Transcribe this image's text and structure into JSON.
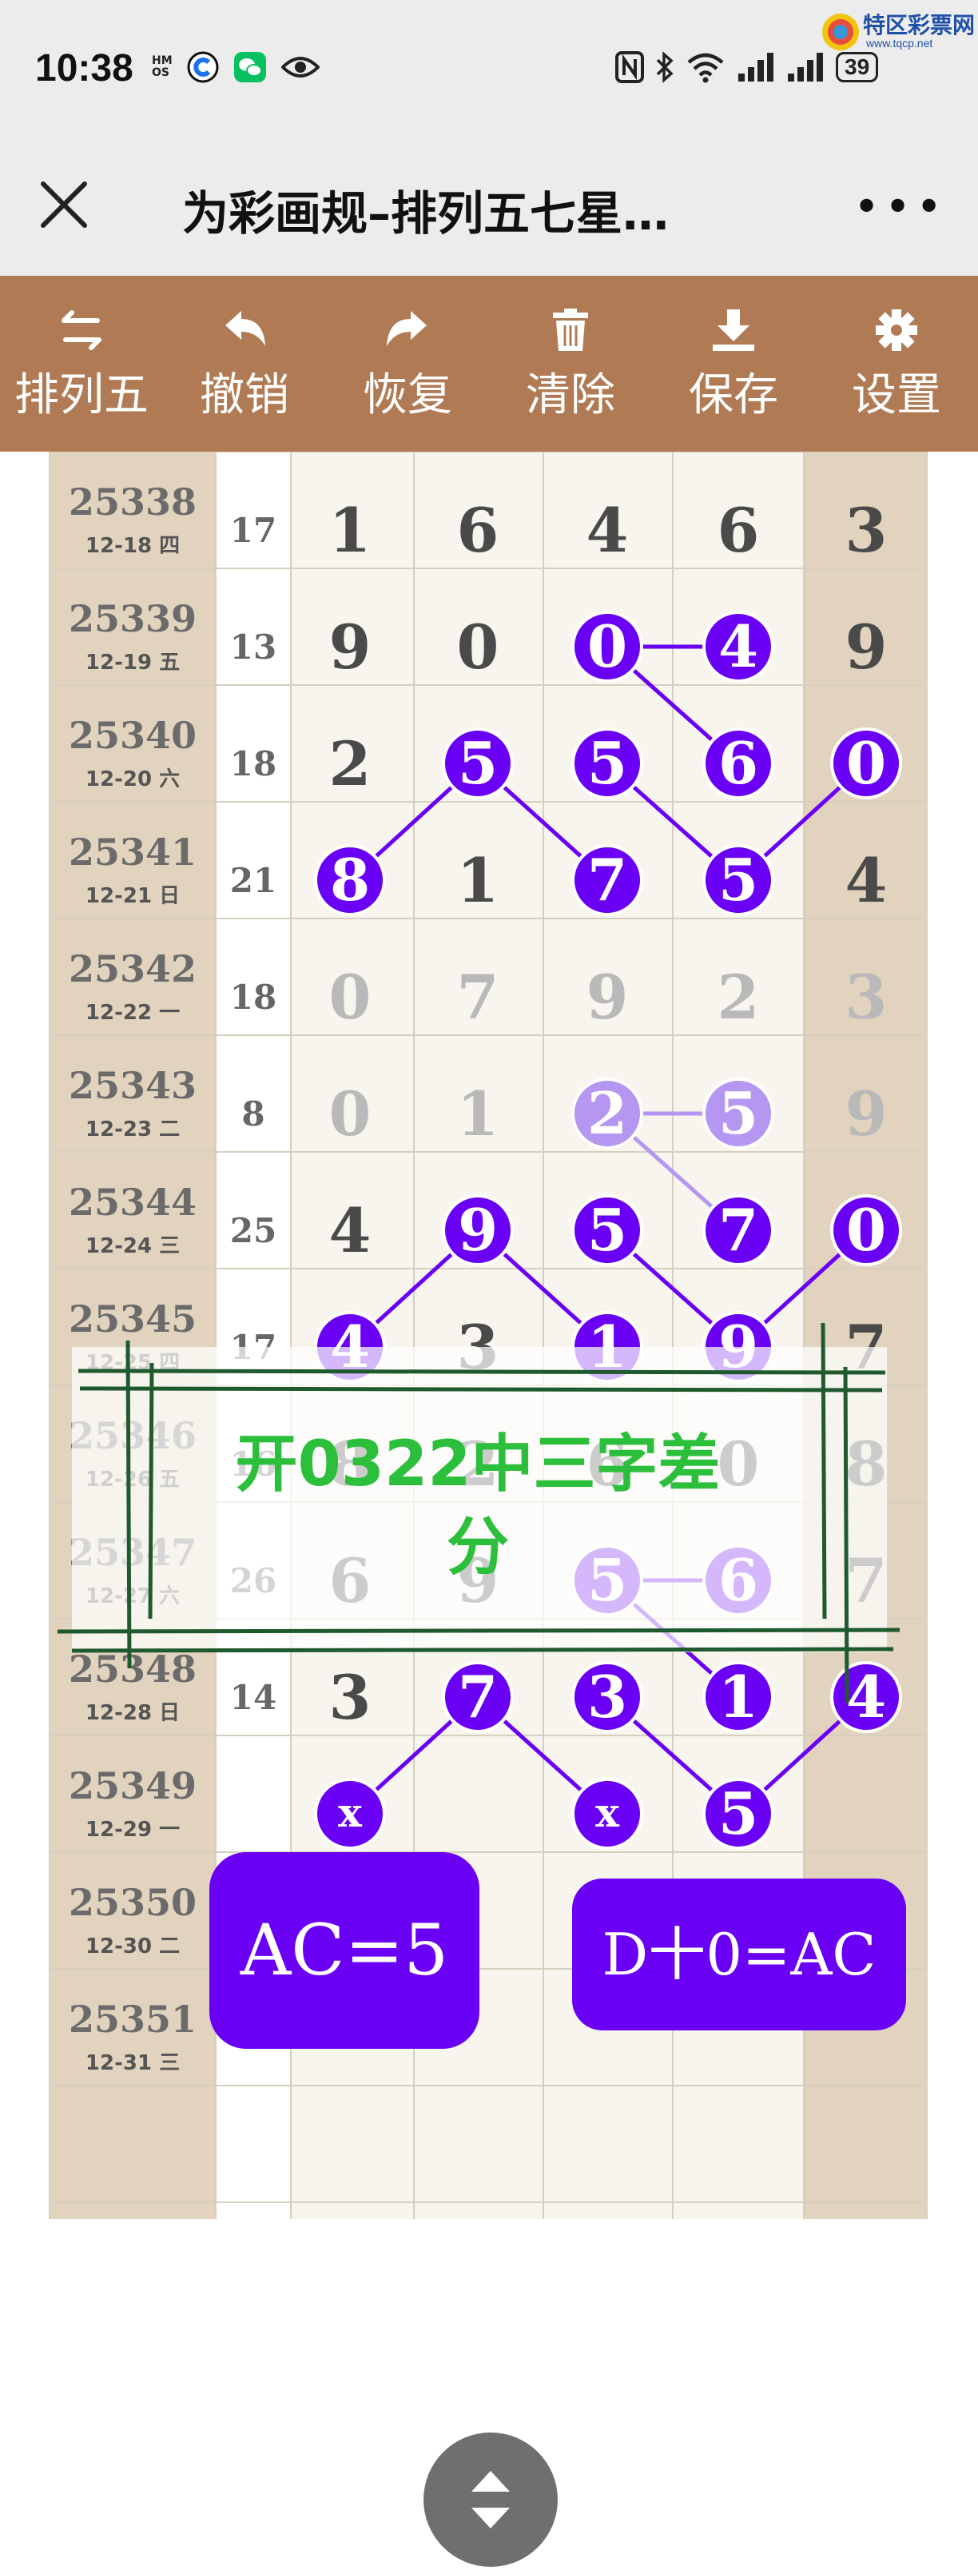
{
  "status": {
    "time": "10:38",
    "hms": [
      "HM",
      "OS"
    ],
    "battery": "39"
  },
  "watermark": {
    "name": "特区彩票网",
    "url": "www.tqcp.net"
  },
  "header": {
    "title": "为彩画规–排列五七星…",
    "more": "•••"
  },
  "toolbar": [
    {
      "label": "排列五",
      "icon": "swap-icon"
    },
    {
      "label": "撤销",
      "icon": "undo-icon"
    },
    {
      "label": "恢复",
      "icon": "redo-icon"
    },
    {
      "label": "清除",
      "icon": "trash-icon"
    },
    {
      "label": "保存",
      "icon": "download-icon"
    },
    {
      "label": "设置",
      "icon": "gear-icon"
    }
  ],
  "rows": [
    {
      "issue": "25338",
      "date": "12-18 四",
      "sum": "17",
      "digits": [
        "1",
        "6",
        "4",
        "6",
        "3"
      ]
    },
    {
      "issue": "25339",
      "date": "12-19 五",
      "sum": "13",
      "digits": [
        "9",
        "0",
        "0",
        "4",
        "9"
      ]
    },
    {
      "issue": "25340",
      "date": "12-20 六",
      "sum": "18",
      "digits": [
        "2",
        "5",
        "5",
        "6",
        "0"
      ]
    },
    {
      "issue": "25341",
      "date": "12-21 日",
      "sum": "21",
      "digits": [
        "8",
        "1",
        "7",
        "5",
        "4"
      ]
    },
    {
      "issue": "25342",
      "date": "12-22 一",
      "sum": "18",
      "digits": [
        "0",
        "7",
        "9",
        "2",
        "3"
      ]
    },
    {
      "issue": "25343",
      "date": "12-23 二",
      "sum": "8",
      "digits": [
        "0",
        "1",
        "2",
        "5",
        "9"
      ]
    },
    {
      "issue": "25344",
      "date": "12-24 三",
      "sum": "25",
      "digits": [
        "4",
        "9",
        "5",
        "7",
        "0"
      ]
    },
    {
      "issue": "25345",
      "date": "12-25 四",
      "sum": "17",
      "digits": [
        "4",
        "3",
        "1",
        "9",
        "7"
      ]
    },
    {
      "issue": "25346",
      "date": "12-26 五",
      "sum": "16",
      "digits": [
        "8",
        "2",
        "6",
        "0",
        "8"
      ]
    },
    {
      "issue": "25347",
      "date": "12-27 六",
      "sum": "26",
      "digits": [
        "6",
        "9",
        "5",
        "6",
        "7"
      ]
    },
    {
      "issue": "25348",
      "date": "12-28 日",
      "sum": "14",
      "digits": [
        "3",
        "7",
        "3",
        "1",
        "4"
      ]
    },
    {
      "issue": "25349",
      "date": "12-29 一",
      "sum": "",
      "digits": [
        "x",
        "",
        "x",
        "5",
        ""
      ]
    },
    {
      "issue": "25350",
      "date": "12-30 二",
      "sum": "",
      "digits": [
        "",
        "",
        "",
        "",
        ""
      ]
    },
    {
      "issue": "25351",
      "date": "12-31 三",
      "sum": "",
      "digits": [
        "",
        "",
        "",
        "",
        ""
      ]
    }
  ],
  "circles": [
    [
      1,
      2
    ],
    [
      1,
      3
    ],
    [
      2,
      1
    ],
    [
      2,
      2
    ],
    [
      2,
      3
    ],
    [
      2,
      4
    ],
    [
      3,
      0
    ],
    [
      3,
      2
    ],
    [
      3,
      3
    ],
    [
      5,
      2
    ],
    [
      5,
      3
    ],
    [
      6,
      1
    ],
    [
      6,
      2
    ],
    [
      6,
      3
    ],
    [
      6,
      4
    ],
    [
      7,
      0
    ],
    [
      7,
      2
    ],
    [
      7,
      3
    ],
    [
      9,
      2
    ],
    [
      9,
      3
    ],
    [
      10,
      1
    ],
    [
      10,
      2
    ],
    [
      10,
      3
    ],
    [
      10,
      4
    ],
    [
      11,
      0
    ],
    [
      11,
      2
    ],
    [
      11,
      3
    ]
  ],
  "faded_circles": [
    [
      5,
      2
    ],
    [
      5,
      3
    ]
  ],
  "links": [
    [
      [
        1,
        2
      ],
      [
        1,
        3
      ]
    ],
    [
      [
        1,
        2
      ],
      [
        2,
        3
      ]
    ],
    [
      [
        3,
        0
      ],
      [
        2,
        1
      ]
    ],
    [
      [
        2,
        1
      ],
      [
        3,
        2
      ]
    ],
    [
      [
        2,
        2
      ],
      [
        3,
        3
      ]
    ],
    [
      [
        3,
        3
      ],
      [
        2,
        4
      ]
    ],
    [
      [
        5,
        2
      ],
      [
        5,
        3
      ]
    ],
    [
      [
        5,
        2
      ],
      [
        6,
        3
      ]
    ],
    [
      [
        7,
        0
      ],
      [
        6,
        1
      ]
    ],
    [
      [
        6,
        1
      ],
      [
        7,
        2
      ]
    ],
    [
      [
        6,
        2
      ],
      [
        7,
        3
      ]
    ],
    [
      [
        7,
        3
      ],
      [
        6,
        4
      ]
    ],
    [
      [
        9,
        2
      ],
      [
        9,
        3
      ]
    ],
    [
      [
        9,
        2
      ],
      [
        10,
        3
      ]
    ],
    [
      [
        11,
        0
      ],
      [
        10,
        1
      ]
    ],
    [
      [
        10,
        1
      ],
      [
        11,
        2
      ]
    ],
    [
      [
        10,
        2
      ],
      [
        11,
        3
      ]
    ],
    [
      [
        11,
        3
      ],
      [
        10,
        4
      ]
    ]
  ],
  "overlay": {
    "line1": "开0322中三字差",
    "line2": "分"
  },
  "badges": {
    "left": "AC=5",
    "right": "D十0=AC"
  },
  "colors": {
    "toolbar": "#b07a54",
    "circle": "#6a00f4",
    "overlay_text": "#2bbf3c",
    "overlay_frame": "#1f5a2e",
    "side_col": "#e2d3bf",
    "digit": "#4a4a4a"
  }
}
